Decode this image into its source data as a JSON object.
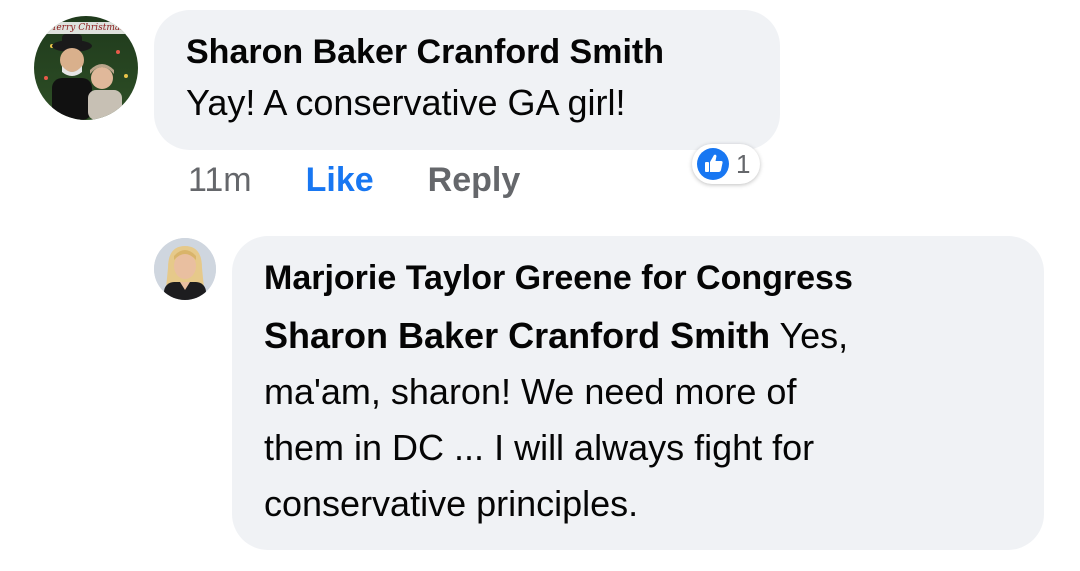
{
  "comment": {
    "avatar_banner": "Merry Christmas",
    "author": "Sharon Baker Cranford Smith",
    "text": "Yay! A conservative GA girl!",
    "time": "11m",
    "like_label": "Like",
    "reply_label": "Reply",
    "reaction_icon": "thumbs-up-icon",
    "reaction_count": "1",
    "colors": {
      "bubble": "#f0f2f5",
      "like_active": "#1877f2",
      "meta": "#65676b",
      "reaction_blue": "#1877f2"
    }
  },
  "reply": {
    "author": "Marjorie Taylor Greene for Congress",
    "mention": "Sharon Baker Cranford Smith",
    "line1_rest": " Yes,",
    "line2": "ma'am, sharon! We need more of",
    "line3": "them in DC ... I will always fight for",
    "line4": "conservative principles."
  }
}
